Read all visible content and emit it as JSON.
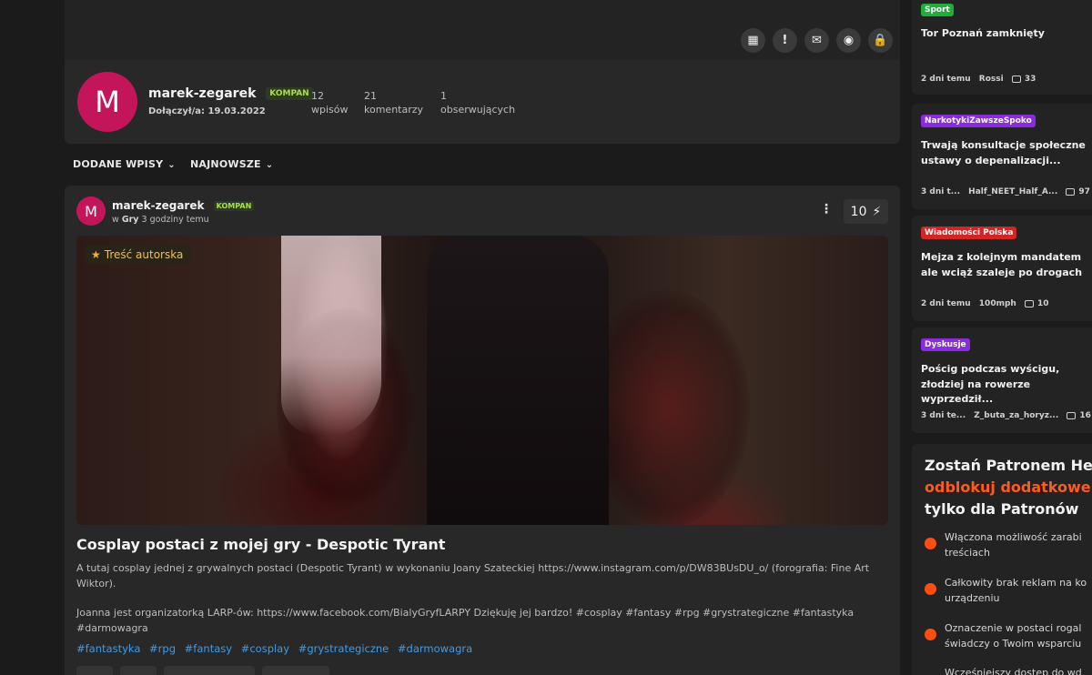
{
  "profile": {
    "avatar_letter": "M",
    "username": "marek-zegarek",
    "rank_badge": "KOMPAN",
    "joined": "Dołączył/a: 19.03.2022",
    "stats": [
      {
        "value": "12",
        "label": "wpisów"
      },
      {
        "value": "21",
        "label": "komentarzy"
      },
      {
        "value": "1",
        "label": "obserwujących"
      }
    ],
    "action_icons": [
      "id-card-icon",
      "report-icon",
      "message-icon",
      "observe-icon",
      "block-icon"
    ]
  },
  "filters": {
    "added_posts": "DODANE WPISY",
    "newest": "NAJNOWSZE"
  },
  "post": {
    "avatar_letter": "M",
    "author": "marek-zegarek",
    "rank_badge": "KOMPAN",
    "meta_prefix": "w",
    "community": "Gry",
    "time": "3 godziny temu",
    "votes": "10",
    "content_tag": "Treść autorska",
    "title": "Cosplay postaci z mojej gry - Despotic Tyrant",
    "body_1": "A tutaj cosplay jednej z grywalnych postaci (Despotic Tyrant) w wykonaniu Joany Szateckiej https://www.instagram.com/p/DW83BUsDU_o/ (forografia: Fine Art Wiktor).",
    "body_2": "Joanna jest organizatorką LARP-ów: https://www.facebook.com/BialyGryfLARPY Dziękuję jej bardzo! #cosplay #fantasy #rpg #grystrategiczne #fantastyka #darmowagra",
    "hashtags": [
      "#fantastyka",
      "#rpg",
      "#fantasy",
      "#cosplay",
      "#grystrategiczne",
      "#darmowagra"
    ]
  },
  "sidebar": {
    "items": [
      {
        "category": "Sport",
        "cat_color": "#1fae3c",
        "title": "Tor Poznań zamknięty",
        "time": "2 dni temu",
        "user": "Rossi",
        "comments": "33"
      },
      {
        "category": "NarkotykiZawszeSpoko",
        "cat_color": "#8a2be2",
        "title": "Trwają konsultacje społeczne ustawy o depenalizacji...",
        "time": "3 dni t...",
        "user": "Half_NEET_Half_A...",
        "comments": "97"
      },
      {
        "category": "Wiadomości Polska",
        "cat_color": "#d42424",
        "title": "Mejza z kolejnym mandatem ale wciąż szaleje po drogach",
        "time": "2 dni temu",
        "user": "100mph",
        "comments": "10"
      },
      {
        "category": "Dyskusje",
        "cat_color": "#8a2be2",
        "title": "Pościg podczas wyścigu, złodziej na rowerze wyprzedził...",
        "time": "3 dni te...",
        "user": "Z_buta_za_horyz...",
        "comments": "16"
      }
    ]
  },
  "patron": {
    "line1": "Zostań Patronem Hejto",
    "line2": "odblokuj dodatkowe k",
    "line3": "tylko dla Patronów",
    "benefits": [
      {
        "line1": "Włączona możliwość zarabi",
        "line2": "treściach"
      },
      {
        "line1": "Całkowity brak reklam na ko",
        "line2": "urządzeniu"
      },
      {
        "line1": "Oznaczenie w postaci rogal",
        "line2": "świadczy o Twoim wsparciu"
      },
      {
        "line1": "Wcześniejszy dostęp do wd",
        "line2": ""
      }
    ]
  }
}
